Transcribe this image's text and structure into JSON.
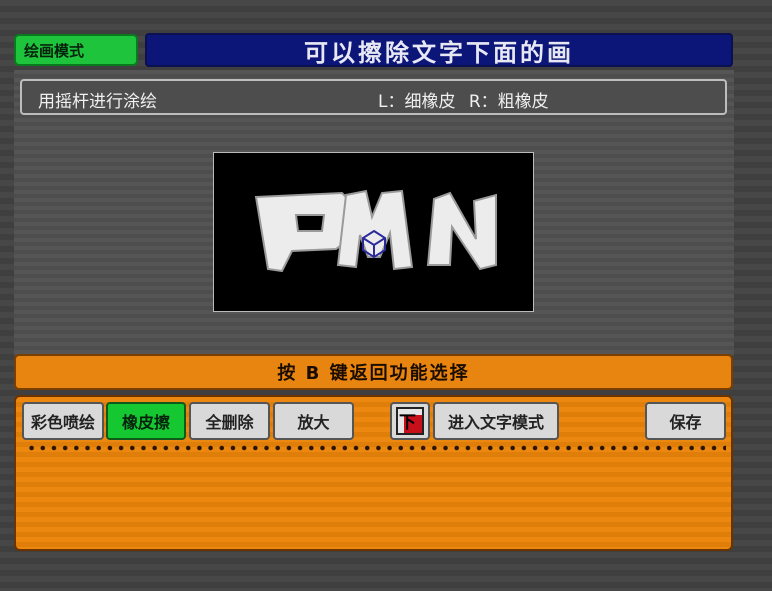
{
  "header": {
    "mode_label": "绘画模式",
    "title": "可以擦除文字下面的画"
  },
  "hint": {
    "left": "用摇杆进行涂绘",
    "right": "L：细橡皮  R：粗橡皮"
  },
  "canvas": {
    "drawn_text": "PMN"
  },
  "notice": "按 B 键返回功能选择",
  "toolbar": {
    "color_spray": "彩色喷绘",
    "eraser": "橡皮擦",
    "clear_all": "全删除",
    "zoom": "放大",
    "down_glyph": "下",
    "text_mode": "进入文字模式",
    "save": "保存"
  },
  "colors": {
    "accent_green": "#15c832",
    "title_blue": "#0c1678",
    "panel_orange": "#e88410"
  }
}
